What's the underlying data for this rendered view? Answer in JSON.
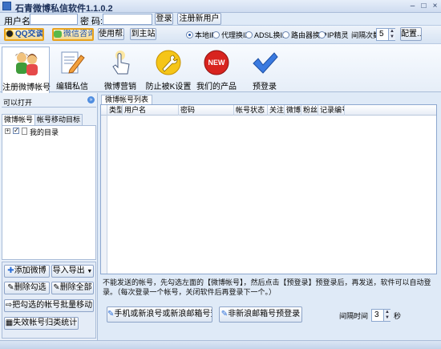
{
  "window": {
    "title": "石青微博私信软件1.1.0.2"
  },
  "login": {
    "username_label": "用户名:",
    "username_value": "",
    "password_label": "密 码:",
    "password_value": "",
    "login_button": "登录",
    "register_button": "注册新用户"
  },
  "toolbar": {
    "qq_button": "QQ交谈",
    "wechat_button": "微信咨询",
    "help_button": "使用帮助",
    "home_button": "到主站",
    "radios": [
      {
        "label": "本地IP",
        "selected": true
      },
      {
        "label": "代理换IP",
        "selected": false
      },
      {
        "label": "ADSL换IP",
        "selected": false
      },
      {
        "label": "路由器换IP",
        "selected": false
      },
      {
        "label": "IP精灵",
        "selected": false
      }
    ],
    "interval_label": "间隔次数",
    "interval_value": "5",
    "config_button": "配置..."
  },
  "big_tools": [
    {
      "label": "注册微博帐号",
      "icon": "users-icon"
    },
    {
      "label": "编辑私信",
      "icon": "edit-icon"
    },
    {
      "label": "微博营销",
      "icon": "pointer-icon"
    },
    {
      "label": "防止被K设置",
      "icon": "wrench-icon"
    },
    {
      "label": "我们的产品",
      "icon": "new-badge-icon"
    },
    {
      "label": "预登录",
      "icon": "checkmark-icon"
    }
  ],
  "left_panel": {
    "header": "可以打开",
    "tabs": [
      "微博帐号",
      "帐号移动目标"
    ],
    "tree_root": "我的目录",
    "buttons": {
      "add": "添加微博",
      "import_export": "导入导出",
      "delete_checked": "删除勾选",
      "delete_all": "删除全部",
      "batch_move": "把勾选的帐号批量移动",
      "invalid_stats": "失效帐号归类统计"
    }
  },
  "main": {
    "group_title": "微博帐号列表",
    "columns": [
      "类型",
      "用户名",
      "密码",
      "帐号状态",
      "关注",
      "微博",
      "粉丝",
      "记录编号"
    ],
    "rows": [],
    "notice": "不能发送的帐号，先勾选左面的【微博帐号】，然后点击【预登录】预登录后，再发送，软件可以自动登录。（每次登录一个帐号，关闭软件后再登录下一个。）",
    "prelogin_phone_button": "手机或新浪号或新浪邮箱号预登录",
    "prelogin_nonsina_button": "非新浪邮箱号预登录",
    "interval_label": "间隔时间",
    "interval_value": "3",
    "interval_unit": "秒"
  },
  "colors": {
    "accent": "#1b4fa8",
    "panel_bg": "#dfeaf7"
  }
}
